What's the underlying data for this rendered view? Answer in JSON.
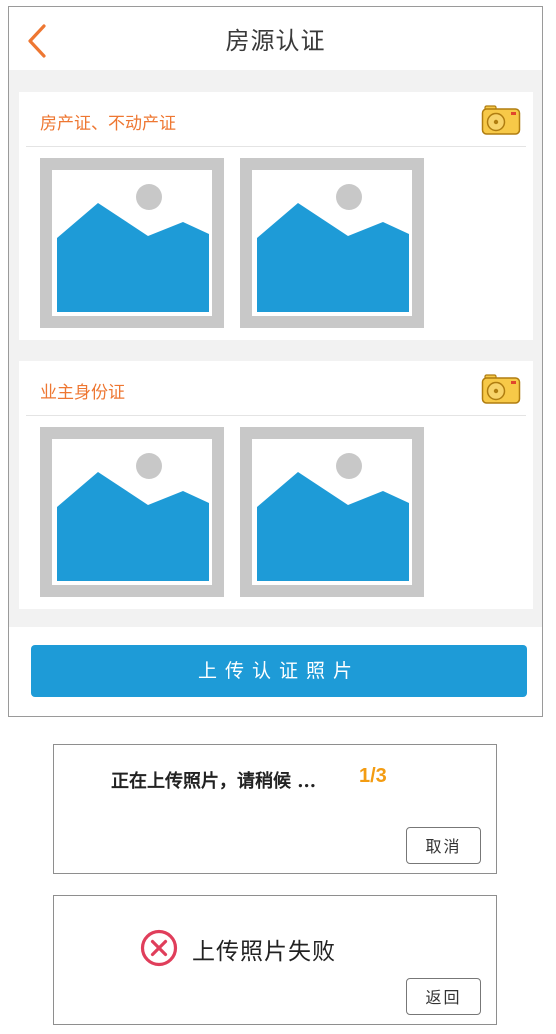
{
  "header": {
    "back_icon": "chevron-left-icon",
    "title": "房源认证"
  },
  "accent_color": "#ee7732",
  "primary_color": "#1e9bd7",
  "sections": [
    {
      "title": "房产证、不动产证",
      "action_icon": "camera-icon",
      "photo_icon": "image-placeholder-icon"
    },
    {
      "title": "业主身份证",
      "action_icon": "camera-icon",
      "photo_icon": "image-placeholder-icon"
    }
  ],
  "upload_button": {
    "label": "上传认证照片"
  },
  "progress_dialog": {
    "message": "正在上传照片，请稍候 ...",
    "count": "1/3",
    "cancel_label": "取消"
  },
  "fail_dialog": {
    "icon": "error-circle-icon",
    "message": "上传照片失败",
    "back_label": "返回"
  }
}
